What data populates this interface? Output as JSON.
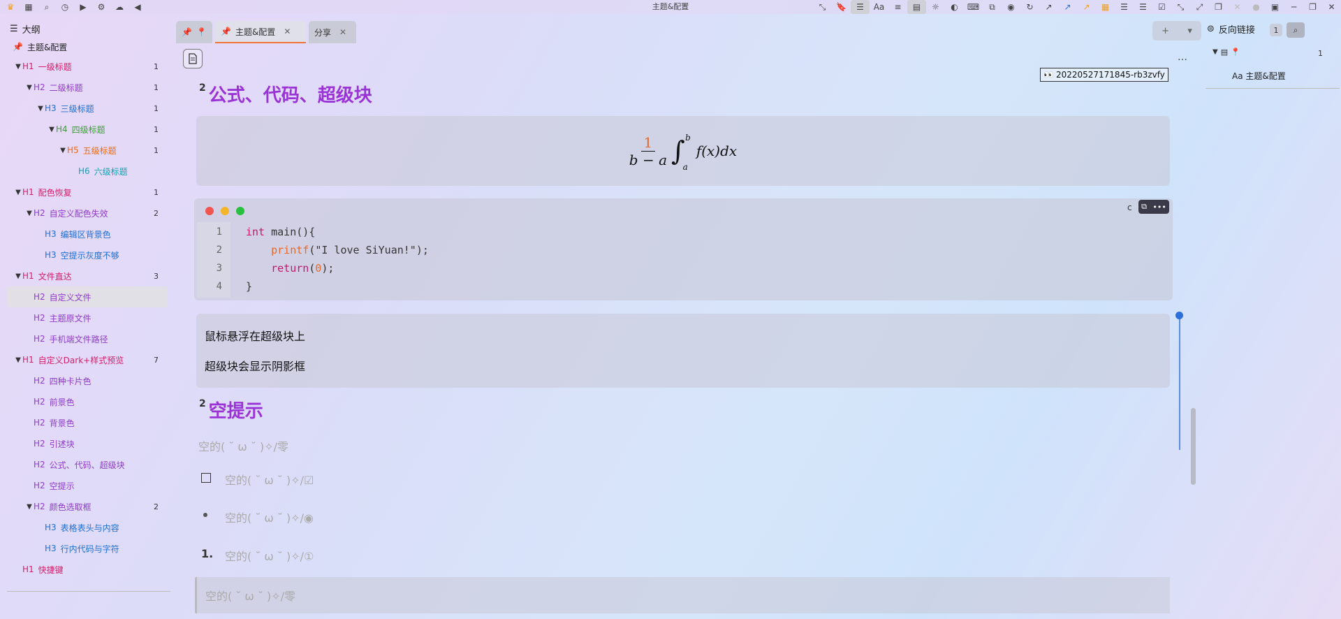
{
  "window": {
    "title": "主题&配置"
  },
  "topbar": {
    "left_icons": [
      "crown-icon",
      "calendar-icon",
      "search-icon",
      "history-icon",
      "play-icon",
      "gear-icon",
      "cloud-icon",
      "back-icon"
    ],
    "right_icon_glyphs": [
      "⤡",
      "🔖",
      "☰",
      "Aa",
      "≡",
      "▤",
      "☼",
      "◐",
      "⌨",
      "⧉",
      "◉",
      "↻",
      "↗",
      "↗",
      "↗",
      "▦",
      "☰",
      "☰",
      "☑",
      "⤡",
      "⤢",
      "❐",
      "✕",
      "●",
      "▣",
      "─",
      "❐",
      "✕"
    ]
  },
  "outline_panel": {
    "header_label": "大纲",
    "doc_title": "主题&配置",
    "items": [
      {
        "level": "H1",
        "label": "一级标题",
        "count": "1",
        "indent": 0,
        "arrow": true
      },
      {
        "level": "H2",
        "label": "二级标题",
        "count": "1",
        "indent": 1,
        "arrow": true
      },
      {
        "level": "H3",
        "label": "三级标题",
        "count": "1",
        "indent": 2,
        "arrow": true
      },
      {
        "level": "H4",
        "label": "四级标题",
        "count": "1",
        "indent": 3,
        "arrow": true
      },
      {
        "level": "H5",
        "label": "五级标题",
        "count": "1",
        "indent": 4,
        "arrow": true
      },
      {
        "level": "H6",
        "label": "六级标题",
        "count": "",
        "indent": 5,
        "arrow": false
      },
      {
        "level": "H1",
        "label": "配色恢复",
        "count": "1",
        "indent": 0,
        "arrow": true
      },
      {
        "level": "H2",
        "label": "自定义配色失效",
        "count": "2",
        "indent": 1,
        "arrow": true
      },
      {
        "level": "H3",
        "label": "编辑区背景色",
        "count": "",
        "indent": 2,
        "arrow": false
      },
      {
        "level": "H3",
        "label": "空提示灰度不够",
        "count": "",
        "indent": 2,
        "arrow": false
      },
      {
        "level": "H1",
        "label": "文件直达",
        "count": "3",
        "indent": 0,
        "arrow": true
      },
      {
        "level": "H2",
        "label": "自定义文件",
        "count": "",
        "indent": 1,
        "arrow": false,
        "selected": true
      },
      {
        "level": "H2",
        "label": "主题原文件",
        "count": "",
        "indent": 1,
        "arrow": false
      },
      {
        "level": "H2",
        "label": "手机端文件路径",
        "count": "",
        "indent": 1,
        "arrow": false
      },
      {
        "level": "H1",
        "label": "自定义Dark+样式预览",
        "count": "7",
        "indent": 0,
        "arrow": true
      },
      {
        "level": "H2",
        "label": "四种卡片色",
        "count": "",
        "indent": 1,
        "arrow": false
      },
      {
        "level": "H2",
        "label": "前景色",
        "count": "",
        "indent": 1,
        "arrow": false
      },
      {
        "level": "H2",
        "label": "背景色",
        "count": "",
        "indent": 1,
        "arrow": false
      },
      {
        "level": "H2",
        "label": "引述块",
        "count": "",
        "indent": 1,
        "arrow": false
      },
      {
        "level": "H2",
        "label": "公式、代码、超级块",
        "count": "",
        "indent": 1,
        "arrow": false
      },
      {
        "level": "H2",
        "label": "空提示",
        "count": "",
        "indent": 1,
        "arrow": false
      },
      {
        "level": "H2",
        "label": "颜色选取框",
        "count": "2",
        "indent": 1,
        "arrow": true
      },
      {
        "level": "H3",
        "label": "表格表头与内容",
        "count": "",
        "indent": 2,
        "arrow": false
      },
      {
        "level": "H3",
        "label": "行内代码与字符",
        "count": "",
        "indent": 2,
        "arrow": false
      },
      {
        "level": "H1",
        "label": "快捷键",
        "count": "",
        "indent": 0,
        "arrow": false
      }
    ]
  },
  "tabs": [
    {
      "label": "",
      "icon": "pin-icon"
    },
    {
      "label": "主题&配置",
      "active": true
    },
    {
      "label": "分享"
    }
  ],
  "tab_add": {
    "plus": "+",
    "dropdown": "▾"
  },
  "editor": {
    "more": "…",
    "block_id": "20220527171845-rb3zvfy",
    "heading1": {
      "sup": "2",
      "text": "公式、代码、超级块"
    },
    "math": {
      "numerator": "1",
      "denominator": "b − a",
      "upper": "b",
      "lower": "a",
      "integrand": "f(x)dx"
    },
    "code": {
      "lang": "c",
      "lines": [
        {
          "n": "1",
          "parts": [
            [
              "kw",
              "int"
            ],
            [
              "t",
              " main(){"
            ]
          ]
        },
        {
          "n": "2",
          "parts": [
            [
              "t",
              "    "
            ],
            [
              "fn",
              "printf"
            ],
            [
              "t",
              "(\"I love SiYuan!\");"
            ]
          ]
        },
        {
          "n": "3",
          "parts": [
            [
              "t",
              "    "
            ],
            [
              "kw",
              "return"
            ],
            [
              "t",
              "("
            ],
            [
              "num",
              "0"
            ],
            [
              "t",
              ");"
            ]
          ]
        },
        {
          "n": "4",
          "parts": [
            [
              "t",
              "}"
            ]
          ]
        }
      ]
    },
    "super_block": {
      "p1": "鼠标悬浮在超级块上",
      "p2": "超级块会显示阴影框"
    },
    "heading2": {
      "sup": "2",
      "text": "空提示"
    },
    "placeholders": {
      "paragraph": "空的( ˘ ω ˘ )✧/零",
      "task": "空的( ˘ ω ˘ )✧/☑",
      "bullet": "空的( ˘ ω ˘ )✧/◉",
      "ordered_num": "1.",
      "ordered": "空的( ˘ ω ˘ )✧/①",
      "quote": "空的( ˘ ω ˘ )✧/零"
    }
  },
  "backlinks": {
    "header_label": "反向链接",
    "badge": "1",
    "row_count": "1",
    "item": "主题&配置",
    "item_prefix": "Aa"
  },
  "colors": {
    "h1": "#d81b6a",
    "h2": "#8e3cc8",
    "h3": "#1f6fd1",
    "h4": "#3f9b3a",
    "h5": "#f06a10",
    "h6": "#16a0b0",
    "heading_doc": "#9a33d6",
    "tab_active_underline": "#f0743a"
  }
}
